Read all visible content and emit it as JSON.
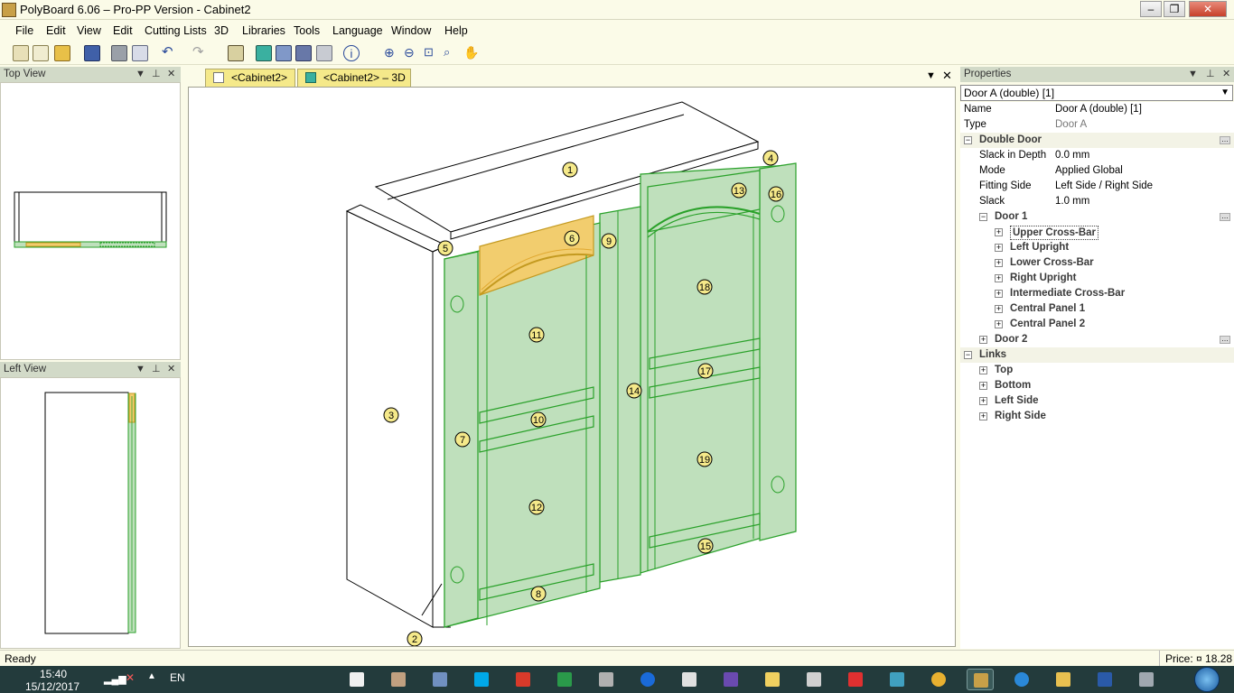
{
  "window": {
    "title": "PolyBoard 6.06 – Pro-PP Version - Cabinet2"
  },
  "menu": [
    "File",
    "Edit",
    "View",
    "Edit",
    "Cutting Lists",
    "3D",
    "Libraries",
    "Tools",
    "Language",
    "Window",
    "Help"
  ],
  "panes": {
    "top_view": "Top View",
    "left_view": "Left View",
    "properties": "Properties"
  },
  "tabs": [
    {
      "label": "<Cabinet2>"
    },
    {
      "label": "<Cabinet2> – 3D"
    }
  ],
  "properties": {
    "selected": "Door A (double) [1]",
    "rows": [
      {
        "key": "Name",
        "value": "Door A (double) [1]",
        "indent": 0,
        "toggle": "",
        "bold": false,
        "muted_value": false
      },
      {
        "key": "Type",
        "value": "Door A",
        "indent": 0,
        "toggle": "",
        "bold": false,
        "muted_value": true
      },
      {
        "key": "Double Door",
        "value": "",
        "indent": 0,
        "toggle": "−",
        "bold": true,
        "ellipsis": true
      },
      {
        "key": "Slack in Depth",
        "value": "0.0 mm",
        "indent": 1,
        "toggle": ""
      },
      {
        "key": "Mode",
        "value": "Applied Global",
        "indent": 1,
        "toggle": ""
      },
      {
        "key": "Fitting Side",
        "value": "Left Side / Right Side",
        "indent": 1,
        "toggle": ""
      },
      {
        "key": "Slack",
        "value": "1.0 mm",
        "indent": 1,
        "toggle": ""
      },
      {
        "key": "Door 1",
        "value": "",
        "indent": 1,
        "toggle": "−",
        "bold": true,
        "ellipsis": true
      },
      {
        "key": "Upper Cross-Bar",
        "value": "",
        "indent": 2,
        "toggle": "+",
        "bold": true,
        "selected": true
      },
      {
        "key": "Left Upright",
        "value": "",
        "indent": 2,
        "toggle": "+",
        "bold": true
      },
      {
        "key": "Lower Cross-Bar",
        "value": "",
        "indent": 2,
        "toggle": "+",
        "bold": true
      },
      {
        "key": "Right Upright",
        "value": "",
        "indent": 2,
        "toggle": "+",
        "bold": true
      },
      {
        "key": "Intermediate Cross-Bar",
        "value": "",
        "indent": 2,
        "toggle": "+",
        "bold": true
      },
      {
        "key": "Central Panel 1",
        "value": "",
        "indent": 2,
        "toggle": "+",
        "bold": true
      },
      {
        "key": "Central Panel 2",
        "value": "",
        "indent": 2,
        "toggle": "+",
        "bold": true
      },
      {
        "key": "Door 2",
        "value": "",
        "indent": 1,
        "toggle": "+",
        "bold": true,
        "ellipsis": true
      },
      {
        "key": "Links",
        "value": "",
        "indent": 0,
        "toggle": "−",
        "bold": true
      },
      {
        "key": "Top",
        "value": "",
        "indent": 1,
        "toggle": "+",
        "bold": true
      },
      {
        "key": "Bottom",
        "value": "",
        "indent": 1,
        "toggle": "+",
        "bold": true
      },
      {
        "key": "Left Side",
        "value": "",
        "indent": 1,
        "toggle": "+",
        "bold": true
      },
      {
        "key": "Right Side",
        "value": "",
        "indent": 1,
        "toggle": "+",
        "bold": true
      }
    ]
  },
  "part_labels": [
    "1",
    "2",
    "3",
    "4",
    "5",
    "6",
    "7",
    "8",
    "9",
    "10",
    "11",
    "12",
    "13",
    "14",
    "15",
    "16",
    "17",
    "18",
    "19"
  ],
  "status": {
    "left": "Ready",
    "price": "Price: ¤ 18.28"
  },
  "taskbar": {
    "time": "15:40",
    "date": "15/12/2017",
    "lang": "EN"
  },
  "colors": {
    "panel_green": "#bfe0bc",
    "edge_green": "#2aa12a",
    "highlight": "#f2cd6e",
    "label_fill": "#f5e98a"
  }
}
